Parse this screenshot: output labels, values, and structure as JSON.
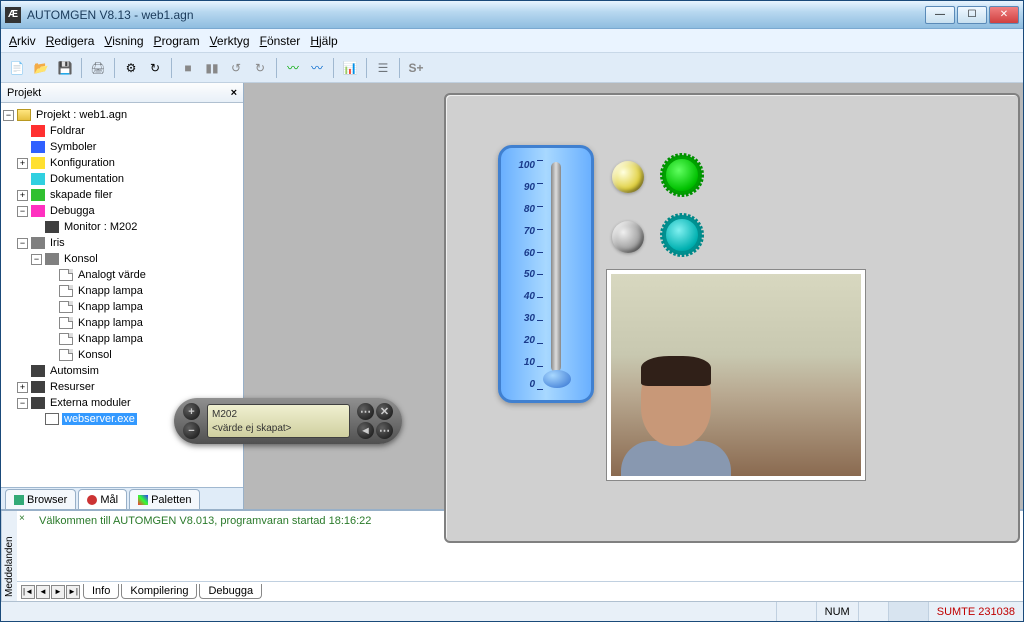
{
  "titlebar": {
    "title": "AUTOMGEN V8.13 - web1.agn"
  },
  "menu": {
    "arkiv": "Arkiv",
    "redigera": "Redigera",
    "visning": "Visning",
    "program": "Program",
    "verktyg": "Verktyg",
    "fonster": "Fönster",
    "hjalp": "Hjälp"
  },
  "panel": {
    "projekt_title": "Projekt",
    "close": "×"
  },
  "tree": {
    "root": "Projekt : web1.agn",
    "foldrar": "Foldrar",
    "symboler": "Symboler",
    "konfiguration": "Konfiguration",
    "dokumentation": "Dokumentation",
    "skapade_filer": "skapade filer",
    "debugga": "Debugga",
    "monitor": "Monitor : M202",
    "iris": "Iris",
    "konsol": "Konsol",
    "analogt_varde": "Analogt värde",
    "knapp_lampa_1": "Knapp lampa",
    "knapp_lampa_2": "Knapp lampa",
    "knapp_lampa_3": "Knapp lampa",
    "knapp_lampa_4": "Knapp lampa",
    "konsol2": "Konsol",
    "automsim": "Automsim",
    "resurser": "Resurser",
    "externa_moduler": "Externa moduler",
    "webserver": "webserver.exe"
  },
  "bottom_tabs": {
    "browser": "Browser",
    "mal": "Mål",
    "paletten": "Paletten"
  },
  "thermometer": {
    "ticks": [
      "100",
      "90",
      "80",
      "70",
      "60",
      "50",
      "40",
      "30",
      "20",
      "10",
      "0"
    ]
  },
  "monitor_widget": {
    "line1": "M202",
    "line2": "<värde ej skapat>"
  },
  "messages": {
    "label": "Meddelanden",
    "welcome": "Välkommen till AUTOMGEN V8.013, programvaran startad 18:16:22",
    "tabs": {
      "info": "Info",
      "kompilering": "Kompilering",
      "debugga": "Debugga"
    }
  },
  "status": {
    "num": "NUM",
    "sumte": "SUMTE 231038"
  }
}
